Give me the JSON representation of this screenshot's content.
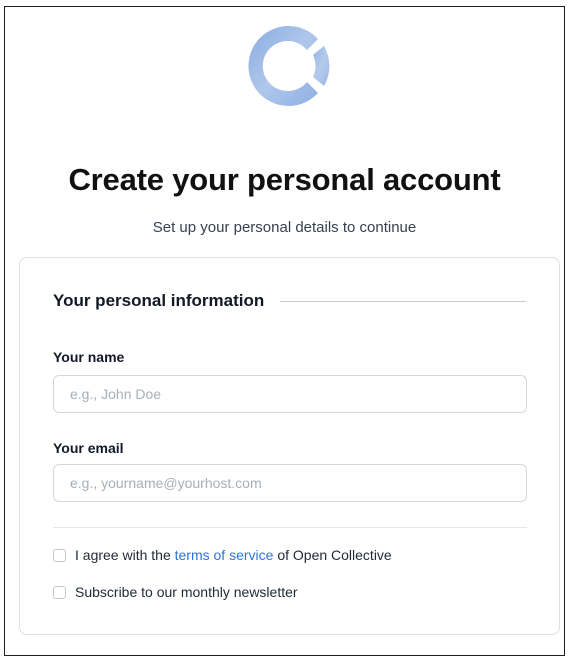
{
  "header": {
    "title": "Create your personal account",
    "subtitle": "Set up your personal details to continue",
    "logo_icon": "open-collective-logo-icon",
    "logo_color": "#8fb0e3"
  },
  "form": {
    "section_title": "Your personal information",
    "name_field": {
      "label": "Your name",
      "value": "",
      "placeholder": "e.g., John Doe"
    },
    "email_field": {
      "label": "Your email",
      "value": "",
      "placeholder": "e.g., yourname@yourhost.com"
    },
    "terms": {
      "checked": false,
      "prefix": "I agree with the ",
      "link_text": "terms of service",
      "suffix": " of Open Collective"
    },
    "newsletter": {
      "checked": false,
      "label": "Subscribe to our monthly newsletter"
    }
  },
  "colors": {
    "link": "#2f74d9",
    "border": "#dcdfe4"
  }
}
